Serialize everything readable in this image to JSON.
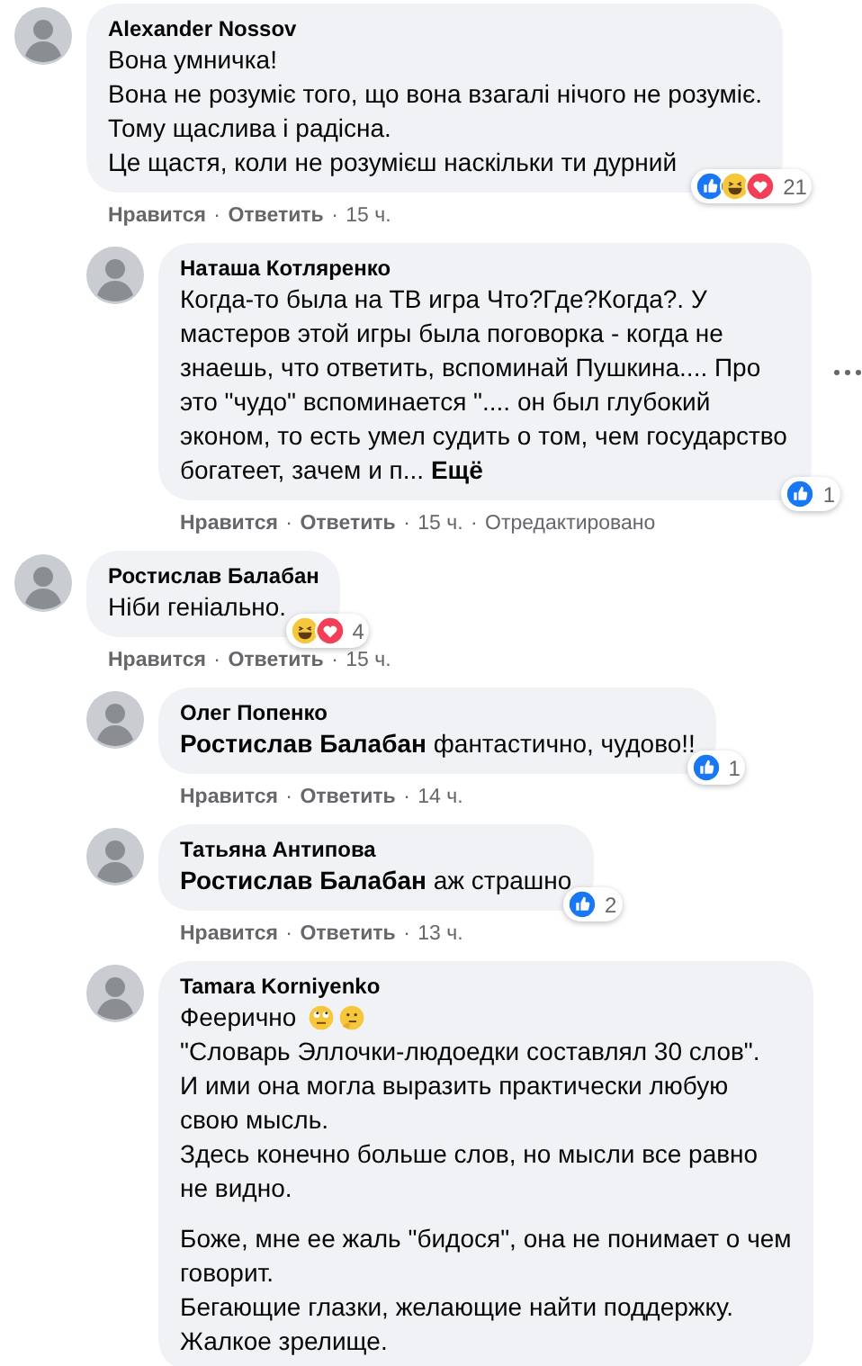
{
  "separator": "·",
  "comments": [
    {
      "name": "Alexander Nossov",
      "show_menu": false,
      "blocks": [
        {
          "lines": [
            {
              "text": "Вона умничка!"
            },
            {
              "text": "Вона не розуміє того, що вона взагалі нічого не розуміє."
            },
            {
              "text": "Тому щаслива і радісна."
            },
            {
              "text": "Це щастя, коли не розумієш наскільки ти дурний"
            }
          ]
        }
      ],
      "reactions": {
        "icons": [
          {
            "kind": "like"
          },
          {
            "kind": "haha"
          },
          {
            "kind": "love"
          }
        ],
        "count": "21"
      },
      "meta": {
        "like": "Нравится",
        "reply": "Ответить",
        "time": "15 ч."
      },
      "children": [
        {
          "name": "Наташа Котляренко",
          "show_menu": true,
          "blocks": [
            {
              "lines": [
                {
                  "text": "Когда-то была на ТВ игра Что?Где?Когда?. У мастеров этой игры была поговорка - когда не знаешь, что ответить, вспоминай Пушкина.... Про это \"чудо\" вспоминается \".... он был глубокий эконом, то есть умел судить о том, чем государство богатеет, зачем и п... **Ещё**"
                }
              ]
            }
          ],
          "reactions": {
            "icons": [
              {
                "kind": "like"
              }
            ],
            "count": "1"
          },
          "meta": {
            "like": "Нравится",
            "reply": "Ответить",
            "time": "15 ч.",
            "edited": "Отредактировано"
          }
        }
      ]
    },
    {
      "name": "Ростислав Балабан",
      "show_menu": false,
      "blocks": [
        {
          "lines": [
            {
              "text": "Ніби геніально."
            }
          ]
        }
      ],
      "reactions": {
        "icons": [
          {
            "kind": "haha"
          },
          {
            "kind": "love"
          }
        ],
        "count": "4"
      },
      "meta": {
        "like": "Нравится",
        "reply": "Ответить",
        "time": "15 ч."
      },
      "children": [
        {
          "name": "Олег Попенко",
          "show_menu": false,
          "blocks": [
            {
              "lines": [
                {
                  "text": "**Ростислав Балабан** фантастично, чудово!!"
                }
              ]
            }
          ],
          "reactions": {
            "icons": [
              {
                "kind": "like"
              }
            ],
            "count": "1"
          },
          "meta": {
            "like": "Нравится",
            "reply": "Ответить",
            "time": "14 ч."
          }
        },
        {
          "name": "Татьяна Антипова",
          "show_menu": false,
          "blocks": [
            {
              "lines": [
                {
                  "text": "**Ростислав Балабан** аж страшно"
                }
              ]
            }
          ],
          "reactions": {
            "icons": [
              {
                "kind": "like"
              }
            ],
            "count": "2"
          },
          "meta": {
            "like": "Нравится",
            "reply": "Ответить",
            "time": "13 ч."
          }
        },
        {
          "name": "Tamara Korniyenko",
          "show_menu": false,
          "blocks": [
            {
              "lines": [
                {
                  "text": "Феерично",
                  "emoji": [
                    {
                      "kind": "eye-roll"
                    },
                    {
                      "kind": "thinking"
                    }
                  ]
                },
                {
                  "text": "\"Словарь Эллочки-людоедки составлял 30 слов\"."
                },
                {
                  "text": "И ими она могла выразить практически любую свою мысль."
                },
                {
                  "text": "Здесь конечно больше слов, но мысли все равно не видно."
                }
              ]
            },
            {
              "lines": [
                {
                  "text": "Боже, мне ее жаль \"бидося\", она не понимает о чем говорит."
                },
                {
                  "text": "Бегающие глазки, желающие найти поддержку."
                },
                {
                  "text": "Жалкое зрелище."
                }
              ]
            }
          ]
        }
      ]
    }
  ]
}
